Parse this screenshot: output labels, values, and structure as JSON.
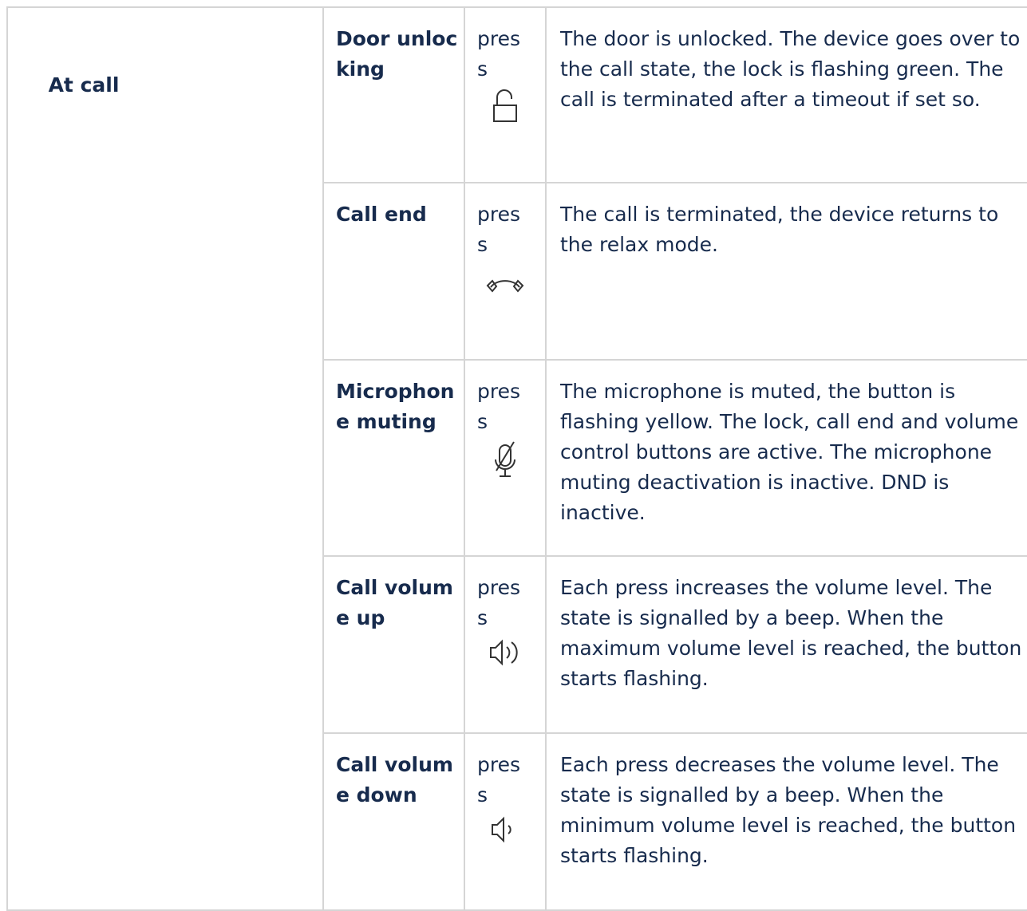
{
  "state": {
    "label": "At call"
  },
  "rows": [
    {
      "function": "Door unlocking",
      "action": "press",
      "icon": "unlocked-padlock-icon",
      "description": "The door is unlocked. The device goes over to the call state, the lock is flashing green. The call is terminated after a timeout if set so."
    },
    {
      "function": "Call end",
      "action": "press",
      "icon": "hang-up-handset-icon",
      "description": "The call is terminated, the device returns to the relax mode."
    },
    {
      "function": "Microphone muting",
      "action": "press",
      "icon": "microphone-muted-icon",
      "description": "The microphone is muted, the button is flashing yellow. The lock, call end and volume control buttons are active. The microphone muting deactivation is inactive. DND is inactive."
    },
    {
      "function": "Call volume up",
      "action": "press",
      "icon": "volume-up-icon",
      "description": "Each press increases the volume level. The state is signalled by a beep. When the maximum volume level is reached, the button starts flashing."
    },
    {
      "function": "Call volume down",
      "action": "press",
      "icon": "volume-down-icon",
      "description": "Each press decreases the volume level. The state is signalled by a beep. When the minimum volume level is reached, the button starts flashing."
    }
  ]
}
